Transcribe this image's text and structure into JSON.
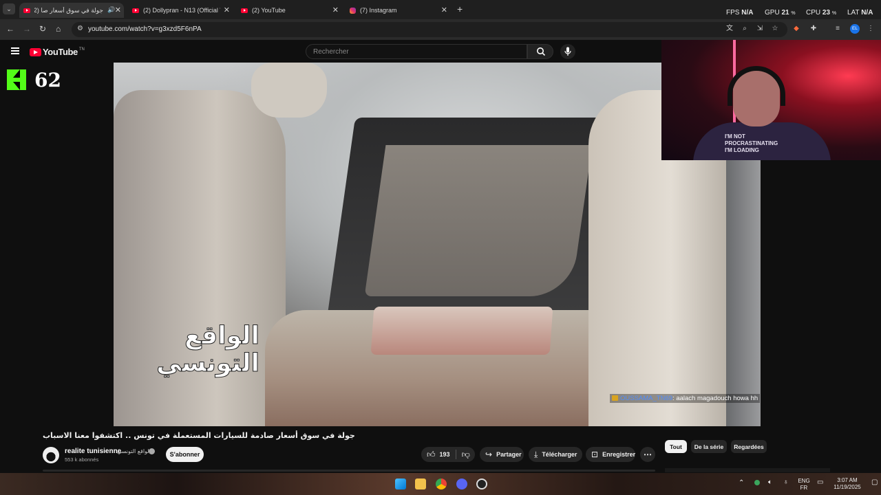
{
  "browser": {
    "tabs": [
      {
        "title": "جولة في سوق أسعار صا (2)",
        "favicon": "youtube-icon",
        "playing": true,
        "active": true
      },
      {
        "title": "(2) Dollypran - N13 (Official Vi",
        "favicon": "youtube-icon"
      },
      {
        "title": "(2) YouTube",
        "favicon": "youtube-icon"
      },
      {
        "title": "(7) Instagram",
        "favicon": "instagram-icon"
      }
    ],
    "url": "youtube.com/watch?v=g3xzd5F6nPA",
    "profile_initials": "EL"
  },
  "perf_overlay": {
    "fps_label": "FPS",
    "fps_value": "N/A",
    "gpu_label": "GPU",
    "gpu_value": "21",
    "cpu_label": "CPU",
    "cpu_value": "23",
    "lat_label": "LAT",
    "lat_value": "N/A",
    "percent_sign": "%"
  },
  "youtube": {
    "logo_text": "YouTube",
    "country_code": "TN",
    "search_placeholder": "Rechercher"
  },
  "stream_overlay": {
    "kick_count": "62",
    "watermark": "الواقع التونسي",
    "chat": {
      "user": "OUSSAMA_TN69",
      "message": "aalach magadouch howa hh"
    },
    "webcam_shirt_text": "I'M NOT PROCRASTINATING I'M LOADING"
  },
  "video": {
    "title": "جولة في سوق أسعار صادمة للسيارات المستعملة في تونس .. اكتشفوا معنا الاسباب",
    "channel_name": "realite tunisienne",
    "channel_name_ar": "الواقع التونسي",
    "subscribers": "553 k abonnés",
    "subscribe_label": "S'abonner",
    "likes": "193",
    "share_label": "Partager",
    "download_label": "Télécharger",
    "save_label": "Enregistrer"
  },
  "chips": [
    "Tout",
    "De la série",
    "Regardées"
  ],
  "taskbar": {
    "lang_top": "ENG",
    "lang_bottom": "FR",
    "time": "3:07 AM",
    "date": "11/19/2025"
  },
  "colors": {
    "youtube_red": "#ff0033",
    "kick_green": "#53fc18",
    "chat_user_blue": "#4f8dff"
  }
}
